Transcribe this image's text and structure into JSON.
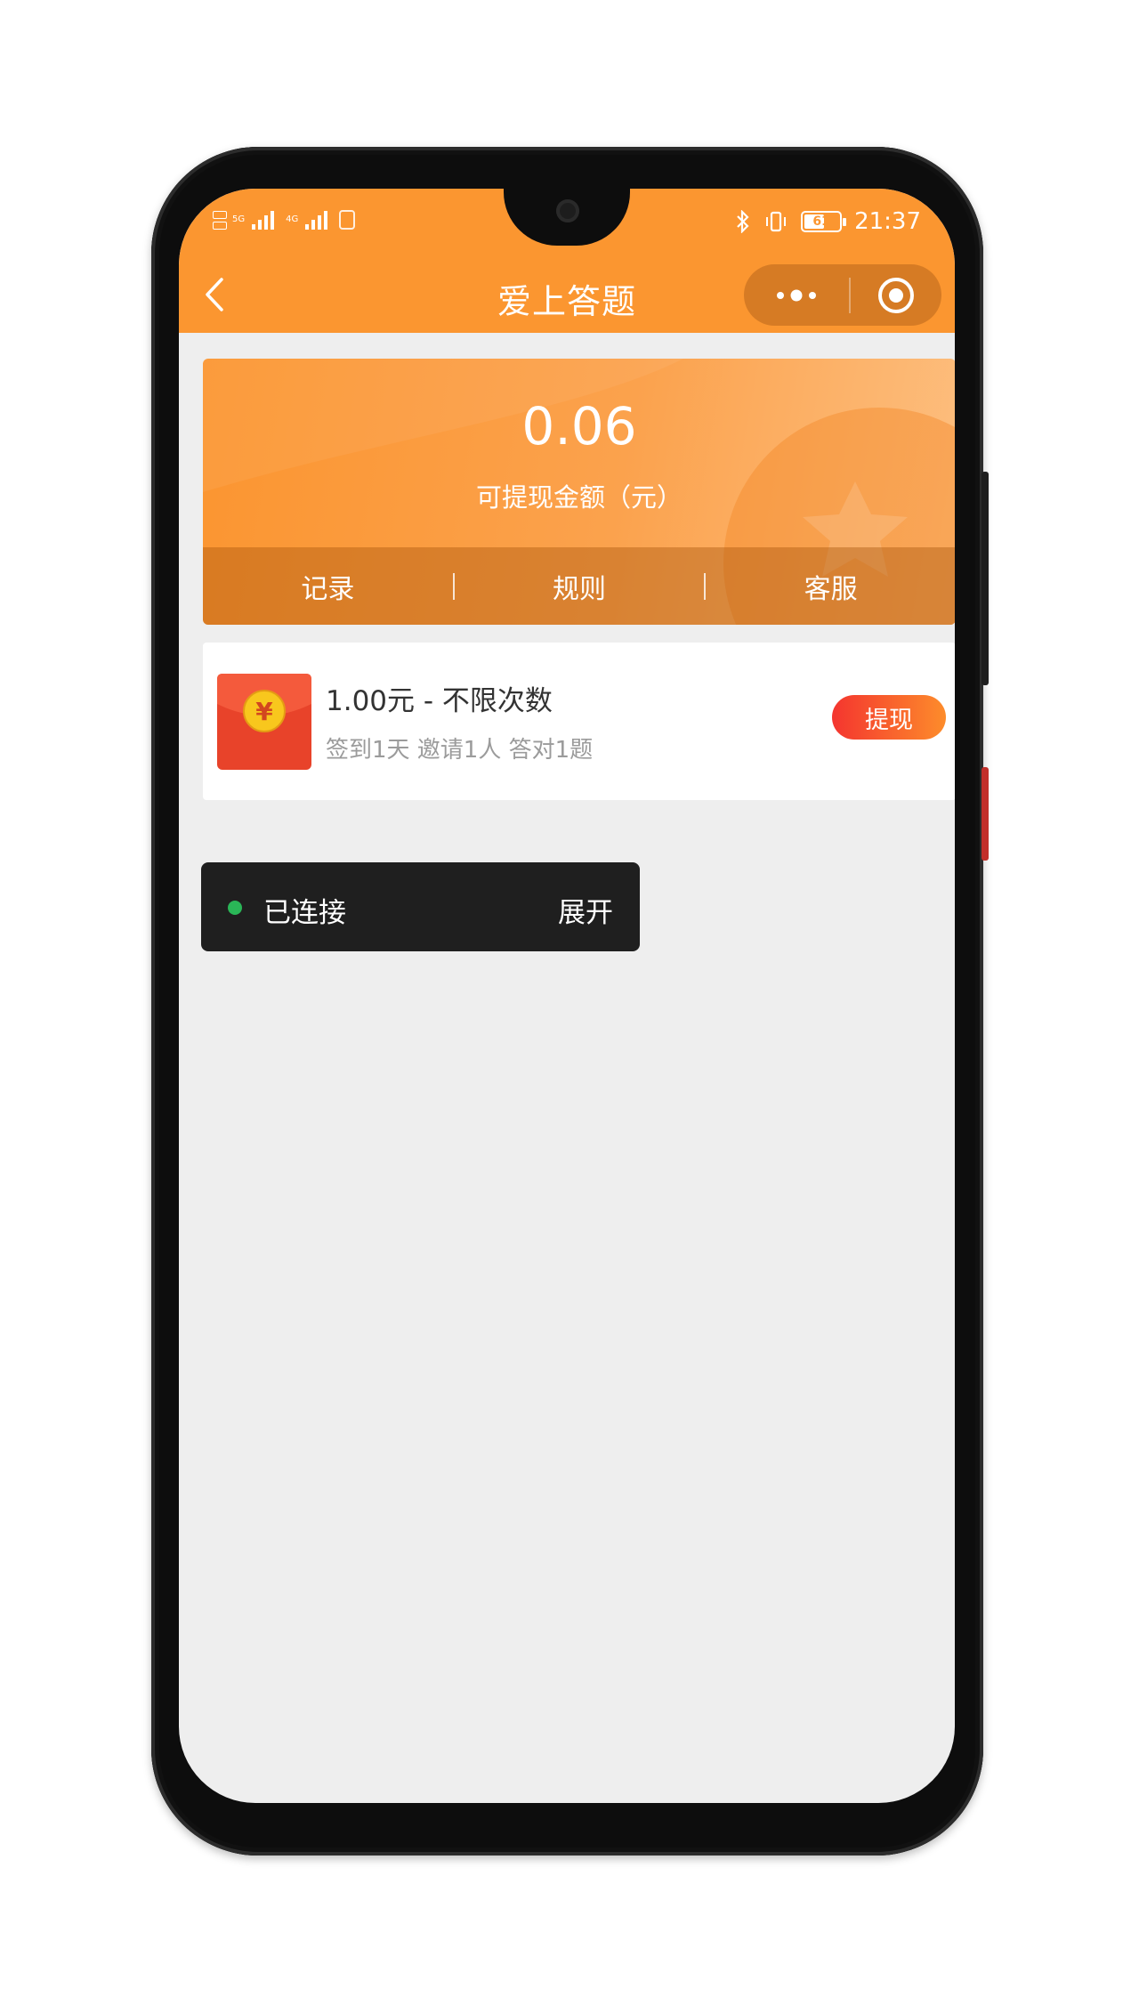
{
  "status_bar": {
    "network_left": "5G",
    "network_right": "4G",
    "battery": "61",
    "battery_level": 0.61,
    "time": "21:37"
  },
  "nav": {
    "title": "爱上答题",
    "icons": {
      "back": "chevron-left-icon",
      "more": "more-dots-icon",
      "close": "target-circle-icon"
    }
  },
  "balance": {
    "amount": "0.06",
    "label": "可提现金额（元）",
    "actions": [
      "记录",
      "规则",
      "客服"
    ]
  },
  "reward": {
    "title": "1.00元 - 不限次数",
    "subtitle": "签到1天 邀请1人 答对1题",
    "button": "提现",
    "icon_symbol": "¥"
  },
  "connection": {
    "status": "已连接",
    "expand": "展开"
  },
  "colors": {
    "primary": "#fb9630",
    "capsule": "#d67b24",
    "button_start": "#f4352f",
    "button_end": "#fd8c2b",
    "connected_dot": "#2ab657",
    "page_bg": "#eeeeee"
  }
}
